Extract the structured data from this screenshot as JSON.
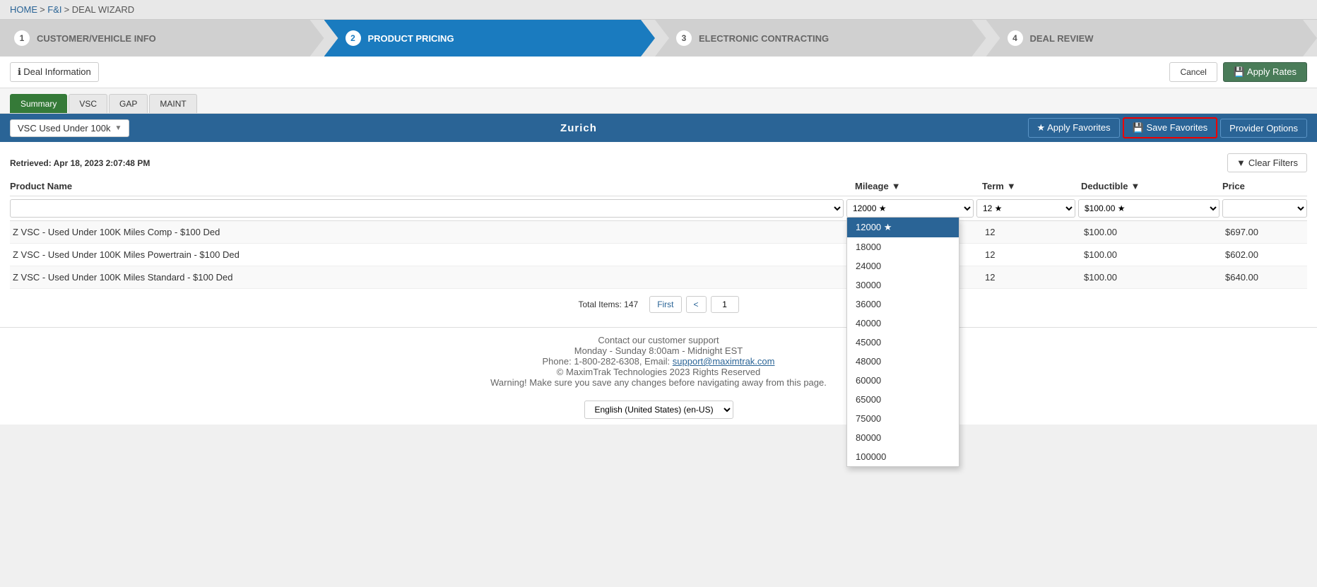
{
  "breadcrumb": {
    "home": "HOME",
    "sep1": ">",
    "fi": "F&I",
    "sep2": ">",
    "current": "DEAL WIZARD"
  },
  "wizard": {
    "steps": [
      {
        "num": "1",
        "label": "CUSTOMER/VEHICLE INFO",
        "active": false
      },
      {
        "num": "2",
        "label": "PRODUCT PRICING",
        "active": true
      },
      {
        "num": "3",
        "label": "ELECTRONIC CONTRACTING",
        "active": false
      },
      {
        "num": "4",
        "label": "DEAL REVIEW",
        "active": false
      }
    ]
  },
  "toolbar": {
    "deal_info_label": "Deal Information",
    "cancel_label": "Cancel",
    "apply_rates_label": "Apply Rates"
  },
  "tabs": {
    "items": [
      {
        "label": "Summary",
        "active": true
      },
      {
        "label": "VSC",
        "active": false
      },
      {
        "label": "GAP",
        "active": false
      },
      {
        "label": "MAINT",
        "active": false
      }
    ]
  },
  "provider_bar": {
    "dropdown_label": "VSC Used Under 100k",
    "provider_name": "Zurich",
    "apply_fav_label": "Apply Favorites",
    "save_fav_label": "Save Favorites",
    "provider_opts_label": "Provider Options"
  },
  "retrieved": {
    "text": "Retrieved: Apr 18, 2023 2:07:48 PM"
  },
  "clear_filters": "Clear Filters",
  "columns": {
    "product_name": "Product Name",
    "mileage": "Mileage",
    "term": "Term",
    "deductible": "Deductible",
    "price": "Price"
  },
  "filters": {
    "mileage_value": "12000 ★",
    "term_value": "12 ★",
    "deductible_value": "$100.00 ★"
  },
  "mileage_dropdown": {
    "options": [
      {
        "value": "12000",
        "label": "12000 ★",
        "selected": true
      },
      {
        "value": "18000",
        "label": "18000",
        "selected": false
      },
      {
        "value": "24000",
        "label": "24000",
        "selected": false
      },
      {
        "value": "30000",
        "label": "30000",
        "selected": false
      },
      {
        "value": "36000",
        "label": "36000",
        "selected": false
      },
      {
        "value": "40000",
        "label": "40000",
        "selected": false
      },
      {
        "value": "45000",
        "label": "45000",
        "selected": false
      },
      {
        "value": "48000",
        "label": "48000",
        "selected": false
      },
      {
        "value": "60000",
        "label": "60000",
        "selected": false
      },
      {
        "value": "65000",
        "label": "65000",
        "selected": false
      },
      {
        "value": "75000",
        "label": "75000",
        "selected": false
      },
      {
        "value": "80000",
        "label": "80000",
        "selected": false
      },
      {
        "value": "100000",
        "label": "100000",
        "selected": false
      }
    ]
  },
  "products": [
    {
      "name": "Z VSC - Used Under 100K Miles Comp - $100 Ded",
      "mileage": "",
      "term": "12",
      "deductible": "$100.00",
      "price": "$697.00"
    },
    {
      "name": "Z VSC - Used Under 100K Miles Powertrain - $100 Ded",
      "mileage": "",
      "term": "12",
      "deductible": "$100.00",
      "price": "$602.00"
    },
    {
      "name": "Z VSC - Used Under 100K Miles Standard - $100 Ded",
      "mileage": "",
      "term": "12",
      "deductible": "$100.00",
      "price": "$640.00"
    }
  ],
  "pagination": {
    "total_label": "Total Items: 147",
    "first_label": "First",
    "prev_label": "<",
    "current_page": "1",
    "next_label": ">"
  },
  "footer": {
    "line1": "Contact our customer support",
    "line2": "Monday - Sunday 8:00am - Midnight EST",
    "line3": "Phone: 1-800-282-6308, Email: support@maximtrak.com",
    "line4": "© MaximTrak Technologies 2023 Rights Reserved",
    "line5": "Warning! Make sure you save any changes before navigating away from this page."
  },
  "language": {
    "value": "English (United States) (en-US)"
  }
}
